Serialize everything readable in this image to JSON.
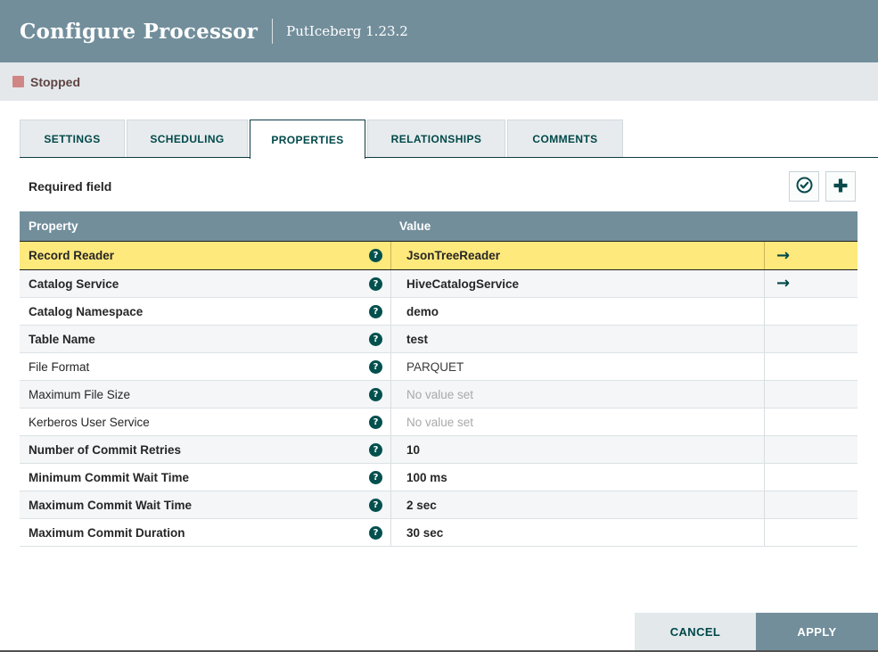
{
  "header": {
    "title": "Configure Processor",
    "processor": "PutIceberg 1.23.2"
  },
  "status": {
    "label": "Stopped",
    "icon": "stop-square-icon"
  },
  "tabs": [
    {
      "label": "SETTINGS",
      "active": false
    },
    {
      "label": "SCHEDULING",
      "active": false
    },
    {
      "label": "PROPERTIES",
      "active": true
    },
    {
      "label": "RELATIONSHIPS",
      "active": false
    },
    {
      "label": "COMMENTS",
      "active": false
    }
  ],
  "properties_panel": {
    "legend": "Required field",
    "toolbar": [
      {
        "name": "verify-properties-button",
        "icon": "circle-check-icon"
      },
      {
        "name": "add-property-button",
        "icon": "plus-icon"
      }
    ],
    "table": {
      "columns": [
        "Property",
        "Value"
      ],
      "help_icon": "question-circle-icon",
      "go_to_service_icon": "arrow-right-icon",
      "rows": [
        {
          "property": "Record Reader",
          "value": "JsonTreeReader",
          "required": true,
          "unset": false,
          "go_to_service": true,
          "selected": true
        },
        {
          "property": "Catalog Service",
          "value": "HiveCatalogService",
          "required": true,
          "unset": false,
          "go_to_service": true,
          "selected": false
        },
        {
          "property": "Catalog Namespace",
          "value": "demo",
          "required": true,
          "unset": false,
          "go_to_service": false,
          "selected": false
        },
        {
          "property": "Table Name",
          "value": "test",
          "required": true,
          "unset": false,
          "go_to_service": false,
          "selected": false
        },
        {
          "property": "File Format",
          "value": "PARQUET",
          "required": false,
          "unset": false,
          "go_to_service": false,
          "selected": false
        },
        {
          "property": "Maximum File Size",
          "value": "No value set",
          "required": false,
          "unset": true,
          "go_to_service": false,
          "selected": false
        },
        {
          "property": "Kerberos User Service",
          "value": "No value set",
          "required": false,
          "unset": true,
          "go_to_service": false,
          "selected": false
        },
        {
          "property": "Number of Commit Retries",
          "value": "10",
          "required": true,
          "unset": false,
          "go_to_service": false,
          "selected": false
        },
        {
          "property": "Minimum Commit Wait Time",
          "value": "100 ms",
          "required": true,
          "unset": false,
          "go_to_service": false,
          "selected": false
        },
        {
          "property": "Maximum Commit Wait Time",
          "value": "2 sec",
          "required": true,
          "unset": false,
          "go_to_service": false,
          "selected": false
        },
        {
          "property": "Maximum Commit Duration",
          "value": "30 sec",
          "required": true,
          "unset": false,
          "go_to_service": false,
          "selected": false
        }
      ]
    }
  },
  "footer": {
    "cancel_label": "CANCEL",
    "apply_label": "APPLY"
  },
  "colors": {
    "header_bg": "#728E9B",
    "status_bar_bg": "#E4E8EB",
    "stopped_red": "#D18686",
    "accent_teal": "#004849",
    "selected_row_yellow": "#FEE97C",
    "row_alt_bg": "#F4F6F7"
  }
}
